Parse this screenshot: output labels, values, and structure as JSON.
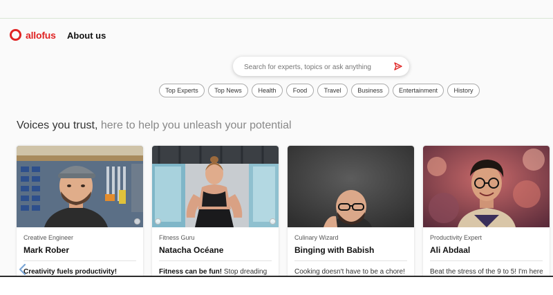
{
  "brand": {
    "name": "allofus",
    "color": "#e02424"
  },
  "nav": {
    "about_label": "About us"
  },
  "search": {
    "placeholder": "Search for experts, topics or ask anything",
    "send_icon": "send-arrow-icon"
  },
  "chips": [
    "Top Experts",
    "Top News",
    "Health",
    "Food",
    "Travel",
    "Business",
    "Entertainment",
    "History"
  ],
  "headline": {
    "strong": "Voices you trust,",
    "light": " here to help you unleash your potential"
  },
  "cards": [
    {
      "role": "Creative Engineer",
      "name": "Mark Rober",
      "blurb_bold": "Creativity fuels productivity!",
      "blurb": ""
    },
    {
      "role": "Fitness Guru",
      "name": "Natacha Océane",
      "blurb_bold": "Fitness can be fun!",
      "blurb": " Stop dreading"
    },
    {
      "role": "Culinary Wizard",
      "name": "Binging with Babish",
      "blurb_bold": "",
      "blurb": "Cooking doesn't have to be a chore!"
    },
    {
      "role": "Productivity Expert",
      "name": "Ali Abdaal",
      "blurb_bold": "",
      "blurb": "Beat the stress of the 9 to 5! I'm here"
    }
  ]
}
